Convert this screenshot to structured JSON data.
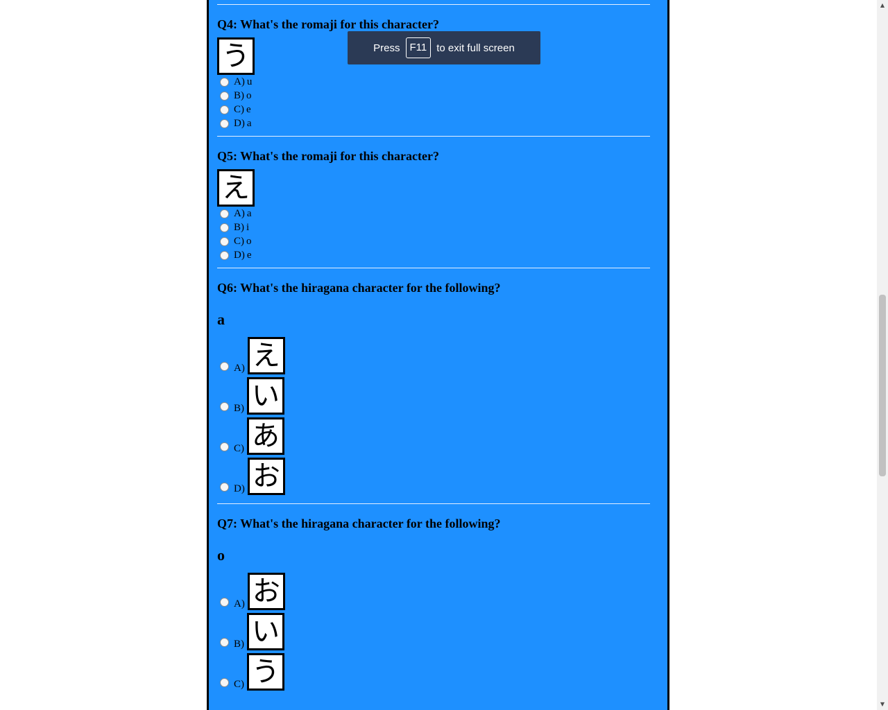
{
  "fullscreen_toast": {
    "prefix": "Press",
    "key": "F11",
    "suffix": "to exit full screen"
  },
  "questions": [
    {
      "title": "Q4: What's the romaji for this character?",
      "character": "う",
      "options": [
        {
          "letter": "A)",
          "text": "u"
        },
        {
          "letter": "B)",
          "text": "o"
        },
        {
          "letter": "C)",
          "text": "e"
        },
        {
          "letter": "D)",
          "text": "a"
        }
      ]
    },
    {
      "title": "Q5: What's the romaji for this character?",
      "character": "え",
      "options": [
        {
          "letter": "A)",
          "text": "a"
        },
        {
          "letter": "B)",
          "text": "i"
        },
        {
          "letter": "C)",
          "text": "o"
        },
        {
          "letter": "D)",
          "text": "e"
        }
      ]
    },
    {
      "title": "Q6: What's the hiragana character for the following?",
      "romaji": "a",
      "options": [
        {
          "letter": "A)",
          "character": "え"
        },
        {
          "letter": "B)",
          "character": "い"
        },
        {
          "letter": "C)",
          "character": "あ"
        },
        {
          "letter": "D)",
          "character": "お"
        }
      ]
    },
    {
      "title": "Q7: What's the hiragana character for the following?",
      "romaji": "o",
      "options": [
        {
          "letter": "A)",
          "character": "お"
        },
        {
          "letter": "B)",
          "character": "い"
        },
        {
          "letter": "C)",
          "character": "う"
        }
      ]
    }
  ]
}
